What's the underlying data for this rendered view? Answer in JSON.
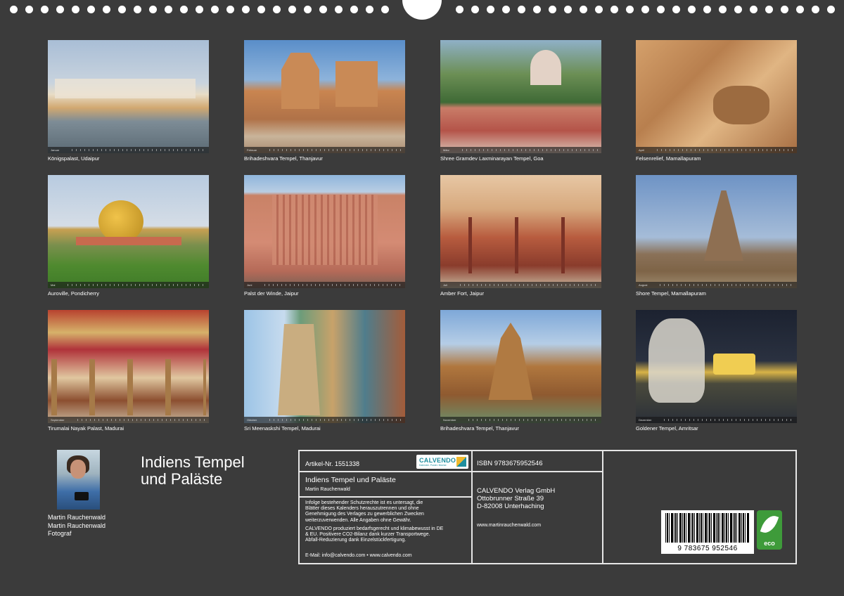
{
  "calendar": {
    "title": "Indiens Tempel und Paläste",
    "title_line1": "Indiens Tempel",
    "title_line2": "und Paläste"
  },
  "months": [
    {
      "month": "Januar",
      "caption": "Königspalast, Udaipur"
    },
    {
      "month": "Februar",
      "caption": "Brihadeshvara Tempel, Thanjavur"
    },
    {
      "month": "März",
      "caption": "Shree Gramdev Laxminarayan Tempel, Goa"
    },
    {
      "month": "April",
      "caption": "Felsenrelief, Mamallapuram"
    },
    {
      "month": "Mai",
      "caption": "Auroville, Pondicherry"
    },
    {
      "month": "Juni",
      "caption": "Palst der Winde, Jaipur"
    },
    {
      "month": "Juli",
      "caption": "Amber Fort, Jaipur"
    },
    {
      "month": "August",
      "caption": "Shore Tempel, Mamallapuram"
    },
    {
      "month": "September",
      "caption": "Tirumalai Nayak Palast, Madurai"
    },
    {
      "month": "Oktober",
      "caption": "Sri Meenaskshi Tempel, Madurai"
    },
    {
      "month": "November",
      "caption": "Brihadeshvara Tempel, Thanjavur"
    },
    {
      "month": "Dezember",
      "caption": "Goldener Tempel, Amritsar"
    }
  ],
  "author": {
    "name": "Martin Rauchenwald",
    "name2": "Martin Rauchenwald",
    "role": "Fotograf"
  },
  "info": {
    "artikel": "Artikel-Nr. 1551338",
    "isbn": "ISBN 9783675952546",
    "title": "Indiens Tempel und Paläste",
    "author": "Martin Rauchenwald",
    "copyright": [
      "Infolge bestehender Schutzrechte ist es untersagt, die",
      "Blätter dieses Kalenders herauszutrennen und ohne",
      "Genehmigung des Verlages zu gewerblichen Zwecken",
      "weiterzuverwenden. Alle Angaben ohne Gewähr."
    ],
    "climate": [
      "CALVENDO produziert bedarfsgerecht und klimabewusst in DE",
      "& EU. Positivere CO2-Bilanz dank kurzer Transportwege.",
      "Abfall-Reduzierung dank Einzelstückfertigung."
    ],
    "contact": "E-Mail: info@calvendo.com • www.calvendo.com",
    "publisher": [
      "CALVENDO Verlag GmbH",
      "Ottobrunner Straße 39",
      "D-82008 Unterhaching"
    ],
    "website": "www.martinrauchenwald.com",
    "logo_word": "CALVENDO",
    "logo_tag": "Kalender. Poster. Bücher.",
    "barcode_number": "9 783675 952546",
    "eco_label": "eco"
  },
  "colors": {
    "background": "#3b3b3b",
    "frame": "#e6e6e6",
    "eco_green": "#3e9b3a",
    "calvendo_teal": "#1e8e9e"
  }
}
